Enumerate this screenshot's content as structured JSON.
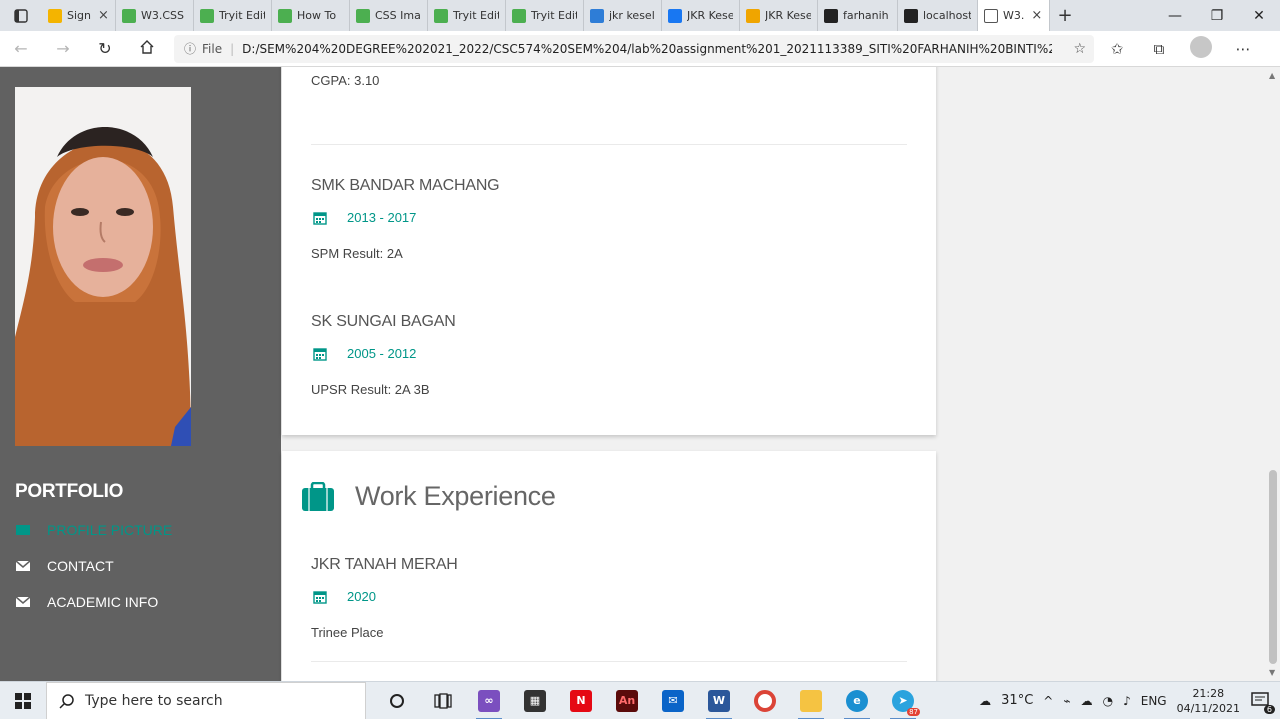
{
  "browser": {
    "tabs": [
      {
        "label": "Sign",
        "favicon_color": "#f4b400"
      },
      {
        "label": "W3.CSS",
        "favicon_color": "#4caf50"
      },
      {
        "label": "Tryit Edit",
        "favicon_color": "#4caf50"
      },
      {
        "label": "How To",
        "favicon_color": "#4caf50"
      },
      {
        "label": "CSS Ima",
        "favicon_color": "#4caf50"
      },
      {
        "label": "Tryit Edit",
        "favicon_color": "#4caf50"
      },
      {
        "label": "Tryit Edit",
        "favicon_color": "#4caf50"
      },
      {
        "label": "jkr kesel",
        "favicon_color": "#2e7dd7"
      },
      {
        "label": "JKR Kese",
        "favicon_color": "#1877f2"
      },
      {
        "label": "JKR Kese",
        "favicon_color": "#f0a500"
      },
      {
        "label": "farhanih",
        "favicon_color": "#222222"
      },
      {
        "label": "localhost",
        "favicon_color": "#222222"
      },
      {
        "label": "W3.",
        "favicon_color": "#ffffff"
      }
    ],
    "address": {
      "info_label": "File",
      "url": "D:/SEM%204%20DEGREE%202021_2022/CSC574%20SEM%204/lab%20assignment%201_2021113389_SITI%20FARHANIH%20BINTI%20A..."
    }
  },
  "sidebar": {
    "title": "PORTFOLIO",
    "links": [
      {
        "label": "PROFILE PICTURE",
        "active": true
      },
      {
        "label": "CONTACT",
        "active": false
      },
      {
        "label": "ACADEMIC INFO",
        "active": false
      }
    ]
  },
  "education": {
    "cgpa": "CGPA: 3.10",
    "entries": [
      {
        "school": "SMK BANDAR MACHANG",
        "years": "2013 - 2017",
        "result": "SPM Result: 2A"
      },
      {
        "school": "SK SUNGAI BAGAN",
        "years": "2005 - 2012",
        "result": "UPSR Result: 2A 3B"
      }
    ]
  },
  "work": {
    "title": "Work Experience",
    "entries": [
      {
        "company": "JKR TANAH MERAH",
        "year": "2020",
        "desc": "Trinee Place"
      }
    ]
  },
  "taskbar": {
    "search_placeholder": "Type here to search",
    "temperature": "31°C",
    "language": "ENG",
    "time": "21:28",
    "date": "04/11/2021",
    "notification_count": "6",
    "telegram_badge": "87"
  },
  "colors": {
    "accent": "#009688",
    "sidebar_bg": "#616161"
  }
}
